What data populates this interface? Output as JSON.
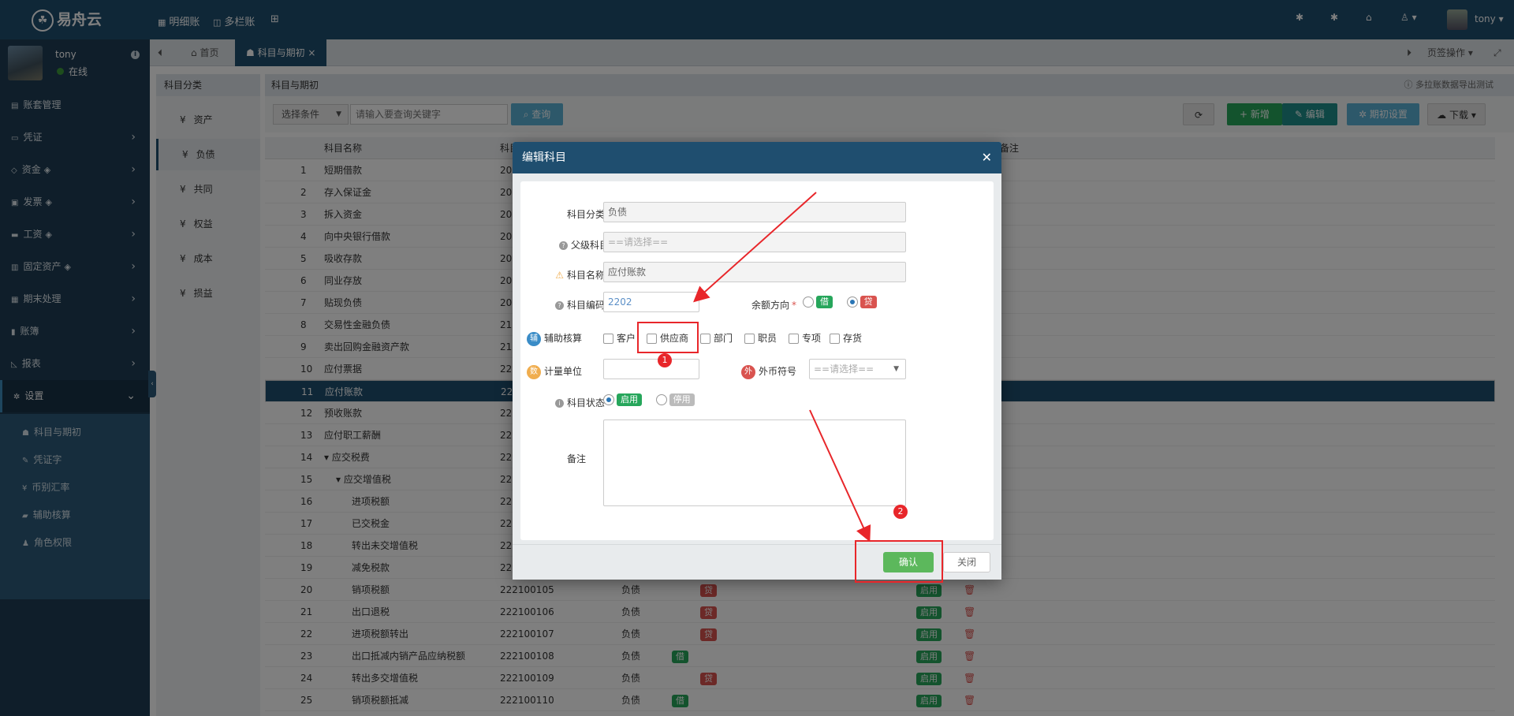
{
  "app": {
    "logo": "易舟云"
  },
  "topnav": [
    {
      "icon": "ledger-icon",
      "label": "明细账"
    },
    {
      "icon": "columns-icon",
      "label": "多栏账"
    },
    {
      "icon": "grid-plus-icon",
      "label": "⊞"
    }
  ],
  "user": {
    "name": "tony",
    "status": "在线"
  },
  "sidebar": {
    "items": [
      {
        "label": "账套管理"
      },
      {
        "label": "凭证"
      },
      {
        "label": "资金"
      },
      {
        "label": "发票"
      },
      {
        "label": "工资"
      },
      {
        "label": "固定资产"
      },
      {
        "label": "期末处理"
      },
      {
        "label": "账簿"
      },
      {
        "label": "报表"
      },
      {
        "label": "设置"
      }
    ],
    "sub": [
      {
        "label": "科目与期初"
      },
      {
        "label": "凭证字"
      },
      {
        "label": "币别汇率"
      },
      {
        "label": "辅助核算"
      },
      {
        "label": "角色权限"
      }
    ]
  },
  "tabs": {
    "home": "首页",
    "current": "科目与期初",
    "page_ops": "页签操作"
  },
  "left_panel": {
    "title": "科目分类",
    "categories": [
      "资产",
      "负债",
      "共同",
      "权益",
      "成本",
      "损益"
    ],
    "active": "负债"
  },
  "main": {
    "title": "科目与期初",
    "hint": "多拉账数据导出测试",
    "filter_label": "选择条件",
    "search_placeholder": "请输入要查询关键字",
    "query": "查询",
    "add": "新增",
    "edit": "编辑",
    "opening": "期初设置",
    "download": "下载"
  },
  "grid": {
    "headers": {
      "name": "科目名称",
      "code": "科目",
      "note": "备注"
    },
    "rows": [
      {
        "no": "1",
        "name": "短期借款",
        "code": "20"
      },
      {
        "no": "2",
        "name": "存入保证金",
        "code": "20"
      },
      {
        "no": "3",
        "name": "拆入资金",
        "code": "20"
      },
      {
        "no": "4",
        "name": "向中央银行借款",
        "code": "20"
      },
      {
        "no": "5",
        "name": "吸收存款",
        "code": "20"
      },
      {
        "no": "6",
        "name": "同业存放",
        "code": "20"
      },
      {
        "no": "7",
        "name": "贴现负债",
        "code": "20"
      },
      {
        "no": "8",
        "name": "交易性金融负债",
        "code": "21"
      },
      {
        "no": "9",
        "name": "卖出回购金融资产款",
        "code": "21"
      },
      {
        "no": "10",
        "name": "应付票据",
        "code": "22"
      },
      {
        "no": "11",
        "name": "应付账款",
        "code": "22"
      },
      {
        "no": "12",
        "name": "预收账款",
        "code": "22"
      },
      {
        "no": "13",
        "name": "应付职工薪酬",
        "code": "22"
      },
      {
        "no": "14",
        "name": "应交税费",
        "code": "22"
      },
      {
        "no": "15",
        "name": "应交增值税",
        "code": "22"
      },
      {
        "no": "16",
        "name": "进项税额",
        "code": "22"
      },
      {
        "no": "17",
        "name": "已交税金",
        "code": "22"
      },
      {
        "no": "18",
        "name": "转出未交增值税",
        "code": "22"
      },
      {
        "no": "19",
        "name": "减免税款",
        "code": "22"
      },
      {
        "no": "20",
        "name": "销项税额",
        "code": "222100105",
        "cat": "负债",
        "dir": "贷",
        "status": "启用"
      },
      {
        "no": "21",
        "name": "出口退税",
        "code": "222100106",
        "cat": "负债",
        "dir": "贷",
        "status": "启用"
      },
      {
        "no": "22",
        "name": "进项税额转出",
        "code": "222100107",
        "cat": "负债",
        "dir": "贷",
        "status": "启用"
      },
      {
        "no": "23",
        "name": "出口抵减内销产品应纳税额",
        "code": "222100108",
        "cat": "负债",
        "dir": "借",
        "status": "启用"
      },
      {
        "no": "24",
        "name": "转出多交增值税",
        "code": "222100109",
        "cat": "负债",
        "dir": "贷",
        "status": "启用"
      },
      {
        "no": "25",
        "name": "销项税额抵减",
        "code": "222100110",
        "cat": "负债",
        "dir": "借",
        "status": "启用"
      }
    ]
  },
  "dialog": {
    "title": "编辑科目",
    "cat_label": "科目分类",
    "cat_value": "负债",
    "parent_label": "父级科目",
    "parent_placeholder": "==请选择==",
    "name_label": "科目名称",
    "name_value": "应付账款",
    "code_label": "科目编码",
    "code_value": "2202",
    "balance_label": "余额方向",
    "debit": "借",
    "credit": "贷",
    "aux_label": "辅助核算",
    "aux_icon": "辅",
    "aux_options": [
      "客户",
      "供应商",
      "部门",
      "职员",
      "专项",
      "存货"
    ],
    "unit_label": "计量单位",
    "unit_icon": "数",
    "currency_label": "外币符号",
    "currency_icon": "外",
    "currency_placeholder": "==请选择==",
    "status_label": "科目状态",
    "enabled": "启用",
    "disabled": "停用",
    "note_label": "备注",
    "ok": "确认",
    "close": "关闭"
  },
  "annotations": [
    "1",
    "2"
  ],
  "colors": {
    "nav": "#1f4e6f",
    "sidebar": "#1e3d54",
    "accent_red": "#e8262a",
    "green": "#5cb85c"
  }
}
